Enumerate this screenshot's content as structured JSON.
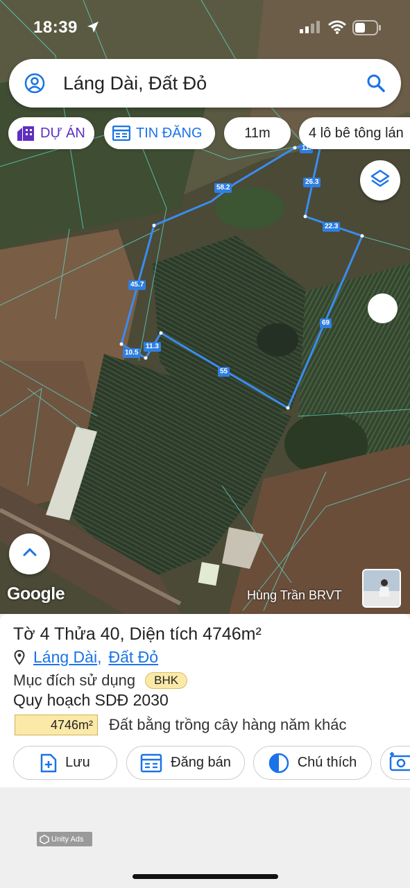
{
  "status_bar": {
    "time": "18:39"
  },
  "search": {
    "query": "Láng Dài, Đất Đỏ"
  },
  "chips": {
    "du_an": "DỰ ÁN",
    "tin_dang": "TIN ĐĂNG",
    "scale": "11m",
    "listing": "4 lô bê tông lán"
  },
  "map": {
    "segment_labels": [
      "11.",
      "26.3",
      "58.2",
      "22.3",
      "45.7",
      "69",
      "11.3",
      "10.5",
      "55"
    ],
    "attribution": "Google",
    "author": "Hùng Trần BRVT",
    "boundary_color": "#3b8cf0"
  },
  "parcel": {
    "title": "Tờ 4 Thửa 40, Diện tích 4746m²",
    "location": {
      "commune": "Láng Dài",
      "separator": ",",
      "district": "Đất Đỏ"
    },
    "usage_label": "Mục đích sử dụng",
    "usage_code": "BHK",
    "plan_title": "Quy hoạch SDĐ 2030",
    "plan_area": "4746m²",
    "plan_desc": "Đất bằng trồng cây hàng năm khác"
  },
  "actions": {
    "save": "Lưu",
    "sell": "Đăng bán",
    "legend": "Chú thích"
  },
  "ads": {
    "label": "Unity Ads"
  }
}
